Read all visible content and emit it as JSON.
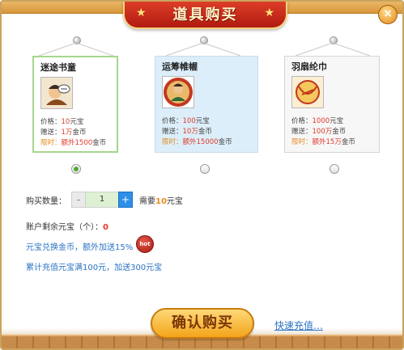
{
  "dialog": {
    "title": "道具购买",
    "close_label": "×"
  },
  "items": [
    {
      "name": "迷途书童",
      "price_label": "价格：",
      "price_value": "10",
      "price_unit": "元宝",
      "gift_label": "赠送：",
      "gift_value": "1万",
      "gift_unit": "金币",
      "limit_label": "限时：",
      "limit_text": "额外1500",
      "limit_unit": "金币",
      "selected": true
    },
    {
      "name": "运筹帷幄",
      "price_label": "价格：",
      "price_value": "100",
      "price_unit": "元宝",
      "gift_label": "赠送：",
      "gift_value": "10万",
      "gift_unit": "金币",
      "limit_label": "限时：",
      "limit_text": "额外15000",
      "limit_unit": "金币",
      "selected": false
    },
    {
      "name": "羽扇纶巾",
      "price_label": "价格：",
      "price_value": "1000",
      "price_unit": "元宝",
      "gift_label": "赠送：",
      "gift_value": "100万",
      "gift_unit": "金币",
      "limit_label": "限时：",
      "limit_text": "额外15万",
      "limit_unit": "金币",
      "selected": false
    }
  ],
  "purchase": {
    "qty_label": "购买数量：",
    "minus": "-",
    "qty_value": "1",
    "plus": "+",
    "need_prefix": "需要",
    "need_amount": "10",
    "need_unit": "元宝"
  },
  "balance": {
    "label": "账户剩余元宝（个）：",
    "value": "0"
  },
  "promos": {
    "exchange_text": "元宝兑换金币，额外加送15%",
    "hot_badge": "hot",
    "recharge_bonus_text": "累计充值元宝满100元，加送300元宝"
  },
  "footer": {
    "confirm_label": "确认购买",
    "recharge_link": "快速充值…"
  },
  "colors": {
    "accent_red": "#e23b2d",
    "accent_orange": "#e58b1f",
    "link_blue": "#2a73c4",
    "qty_plus_blue": "#2e8ee8"
  }
}
